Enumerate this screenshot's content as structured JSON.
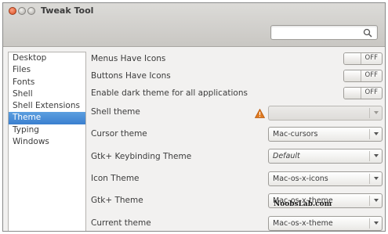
{
  "window": {
    "title": "Tweak Tool"
  },
  "search": {
    "placeholder": ""
  },
  "sidebar": {
    "items": [
      {
        "label": "Desktop",
        "selected": false
      },
      {
        "label": "Files",
        "selected": false
      },
      {
        "label": "Fonts",
        "selected": false
      },
      {
        "label": "Shell",
        "selected": false
      },
      {
        "label": "Shell Extensions",
        "selected": false
      },
      {
        "label": "Theme",
        "selected": true
      },
      {
        "label": "Typing",
        "selected": false
      },
      {
        "label": "Windows",
        "selected": false
      }
    ]
  },
  "settings": {
    "toggles": [
      {
        "label": "Menus Have Icons",
        "state": "OFF"
      },
      {
        "label": "Buttons Have Icons",
        "state": "OFF"
      },
      {
        "label": "Enable dark theme for all applications",
        "state": "OFF"
      }
    ],
    "shell_theme": {
      "label": "Shell theme",
      "value": "",
      "disabled": true,
      "warning_icon": "warning-icon"
    },
    "cursor_theme": {
      "label": "Cursor theme",
      "value": "Mac-cursors"
    },
    "keybinding_theme": {
      "label": "Gtk+ Keybinding Theme",
      "value": "Default"
    },
    "icon_theme": {
      "label": "Icon Theme",
      "value": "Mac-os-x-icons"
    },
    "gtk_theme": {
      "label": "Gtk+ Theme",
      "value": "Mac-os-x-theme"
    },
    "current_theme": {
      "label": "Current theme",
      "value": "Mac-os-x-theme"
    }
  },
  "watermark": "NoobsLab.com",
  "colors": {
    "selection": "#3a7fcf",
    "close_button": "#dd4a1b",
    "warning": "#e07b20"
  }
}
